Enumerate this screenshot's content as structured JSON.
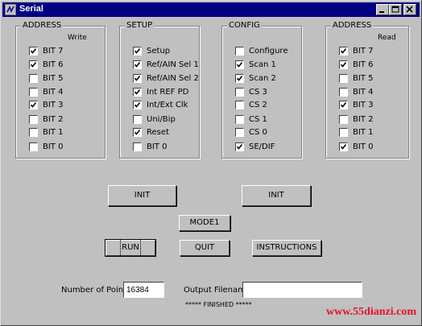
{
  "window": {
    "title": "Serial",
    "controls": {
      "minimize_icon": "minimize-icon",
      "maximize_icon": "maximize-icon",
      "close_icon": "close-icon"
    }
  },
  "groups": [
    {
      "title": "ADDRESS",
      "subtitle": "Write",
      "items": [
        {
          "label": "BIT 7",
          "checked": true
        },
        {
          "label": "BIT 6",
          "checked": true
        },
        {
          "label": "BIT 5",
          "checked": false
        },
        {
          "label": "BIT 4",
          "checked": false
        },
        {
          "label": "BIT 3",
          "checked": true
        },
        {
          "label": "BIT 2",
          "checked": false
        },
        {
          "label": "BIT 1",
          "checked": false
        },
        {
          "label": "BIT 0",
          "checked": false
        }
      ]
    },
    {
      "title": "SETUP",
      "subtitle": "",
      "items": [
        {
          "label": "Setup",
          "checked": true
        },
        {
          "label": "Ref/AIN Sel 1",
          "checked": true
        },
        {
          "label": "Ref/AIN Sel 2",
          "checked": true
        },
        {
          "label": "Int REF PD",
          "checked": true
        },
        {
          "label": "Int/Ext Clk",
          "checked": true
        },
        {
          "label": "Uni/Bip",
          "checked": false
        },
        {
          "label": "Reset",
          "checked": true
        },
        {
          "label": "BIT 0",
          "checked": false
        }
      ]
    },
    {
      "title": "CONFIG",
      "subtitle": "",
      "items": [
        {
          "label": "Configure",
          "checked": false
        },
        {
          "label": "Scan 1",
          "checked": true
        },
        {
          "label": "Scan 2",
          "checked": true
        },
        {
          "label": "CS 3",
          "checked": false
        },
        {
          "label": "CS 2",
          "checked": false
        },
        {
          "label": "CS 1",
          "checked": false
        },
        {
          "label": "CS 0",
          "checked": false
        },
        {
          "label": "SE/DIF",
          "checked": true
        }
      ]
    },
    {
      "title": "ADDRESS",
      "subtitle": "Read",
      "items": [
        {
          "label": "BIT 7",
          "checked": true
        },
        {
          "label": "BIT 6",
          "checked": true
        },
        {
          "label": "BIT 5",
          "checked": false
        },
        {
          "label": "BIT 4",
          "checked": false
        },
        {
          "label": "BIT 3",
          "checked": true
        },
        {
          "label": "BIT 2",
          "checked": false
        },
        {
          "label": "BIT 1",
          "checked": false
        },
        {
          "label": "BIT 0",
          "checked": true
        }
      ]
    }
  ],
  "buttons": {
    "init_left": "INIT",
    "init_right": "INIT",
    "mode1": "MODE1",
    "run": "RUN",
    "quit": "QUIT",
    "instructions": "INSTRUCTIONS"
  },
  "fields": {
    "points_label": "Number of Points",
    "points_value": "16384",
    "filename_label": "Output Filename",
    "filename_value": ""
  },
  "status": "***** FINISHED *****",
  "watermark": "www.55dianzi.com",
  "colors": {
    "titlebar": "#000080",
    "face": "#c0c0c0",
    "watermark": "#e8102a"
  }
}
